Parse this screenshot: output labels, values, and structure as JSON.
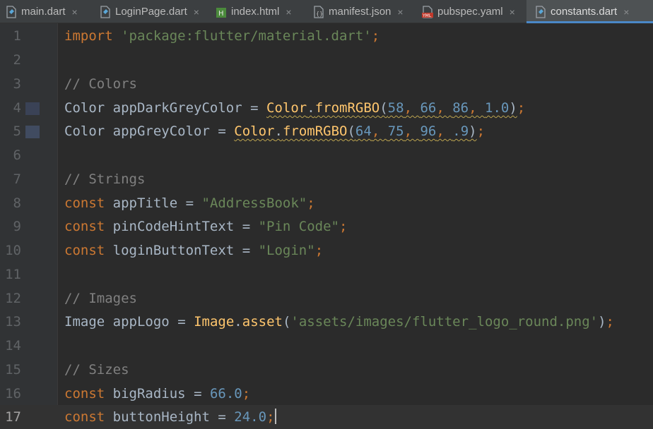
{
  "tabs": [
    {
      "label": "main.dart",
      "icon": "dart-file-icon",
      "active": false
    },
    {
      "label": "LoginPage.dart",
      "icon": "dart-file-icon",
      "active": false
    },
    {
      "label": "index.html",
      "icon": "html-file-icon",
      "active": false
    },
    {
      "label": "manifest.json",
      "icon": "json-file-icon",
      "active": false
    },
    {
      "label": "pubspec.yaml",
      "icon": "yaml-file-icon",
      "active": false
    },
    {
      "label": "constants.dart",
      "icon": "dart-file-icon",
      "active": true
    }
  ],
  "tab_close_glyph": "×",
  "line_numbers": [
    "1",
    "2",
    "3",
    "4",
    "5",
    "6",
    "7",
    "8",
    "9",
    "10",
    "11",
    "12",
    "13",
    "14",
    "15",
    "16",
    "17"
  ],
  "current_line": 17,
  "color_swatches": {
    "line4": "#3a4256",
    "line5": "#404b60"
  },
  "code": {
    "l1": {
      "kw": "import",
      "str": "'package:flutter/material.dart'",
      "semi": ";"
    },
    "l3": {
      "comment": "// Colors"
    },
    "l4": {
      "type": "Color",
      "name": "appDarkGreyColor",
      "eq": "=",
      "cls": "Color",
      "dot": ".",
      "fn": "fromRGBO",
      "open": "(",
      "a": "58",
      "b": "66",
      "c": "86",
      "d": "1.0",
      "close": ")",
      "semi": ";"
    },
    "l5": {
      "type": "Color",
      "name": "appGreyColor",
      "eq": "=",
      "cls": "Color",
      "dot": ".",
      "fn": "fromRGBO",
      "open": "(",
      "a": "64",
      "b": "75",
      "c": "96",
      "d": ".9",
      "close": ")",
      "semi": ";"
    },
    "l7": {
      "comment": "// Strings"
    },
    "l8": {
      "kw": "const",
      "name": "appTitle",
      "eq": "=",
      "str": "\"AddressBook\"",
      "semi": ";"
    },
    "l9": {
      "kw": "const",
      "name": "pinCodeHintText",
      "eq": "=",
      "str": "\"Pin Code\"",
      "semi": ";"
    },
    "l10": {
      "kw": "const",
      "name": "loginButtonText",
      "eq": "=",
      "str": "\"Login\"",
      "semi": ";"
    },
    "l12": {
      "comment": "// Images"
    },
    "l13": {
      "type": "Image",
      "name": "appLogo",
      "eq": "=",
      "cls": "Image",
      "dot": ".",
      "fn": "asset",
      "open": "(",
      "str": "'assets/images/flutter_logo_round.png'",
      "close": ")",
      "semi": ";"
    },
    "l15": {
      "comment": "// Sizes"
    },
    "l16": {
      "kw": "const",
      "name": "bigRadius",
      "eq": "=",
      "num": "66.0",
      "semi": ";"
    },
    "l17": {
      "kw": "const",
      "name": "buttonHeight",
      "eq": "=",
      "num": "24.0",
      "semi": ";"
    }
  }
}
